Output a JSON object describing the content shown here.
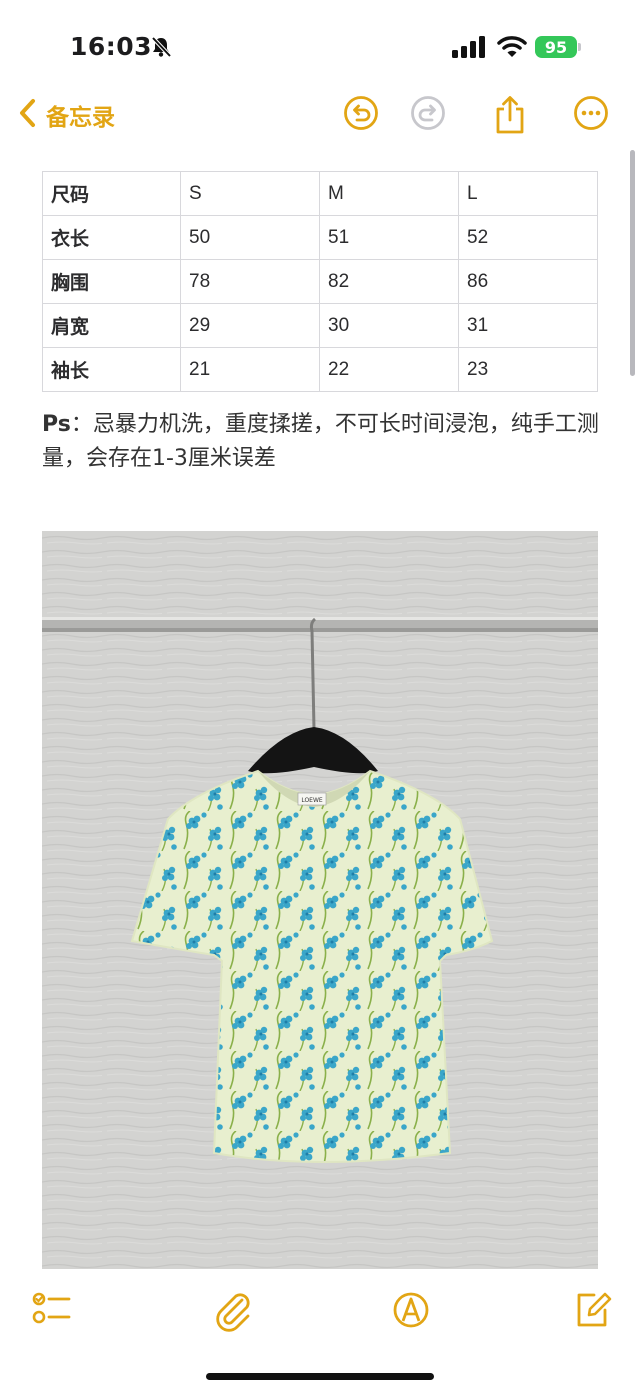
{
  "status_bar": {
    "time": "16:03",
    "battery": "95"
  },
  "nav": {
    "back_label": "备忘录"
  },
  "size_table": {
    "rows": [
      [
        "尺码",
        "S",
        "M",
        "L"
      ],
      [
        "衣长",
        "50",
        "51",
        "52"
      ],
      [
        "胸围",
        "78",
        "82",
        "86"
      ],
      [
        "肩宽",
        "29",
        "30",
        "31"
      ],
      [
        "袖长",
        "21",
        "22",
        "23"
      ]
    ]
  },
  "note": {
    "prefix": "Ps",
    "text": "：忌暴力机洗，重度揉搓，不可长时间浸泡，纯手工测量，会存在1-3厘米误差"
  },
  "photo": {
    "label_text": "LOEWE"
  },
  "icons": {
    "accent": "#e2a514",
    "disabled": "#c7c7cc",
    "names": [
      "bell-slash-icon",
      "signal-icon",
      "wifi-icon",
      "chevron-left-icon",
      "undo-icon",
      "redo-icon",
      "share-icon",
      "more-icon",
      "checklist-icon",
      "paperclip-icon",
      "markup-icon",
      "compose-icon"
    ]
  }
}
